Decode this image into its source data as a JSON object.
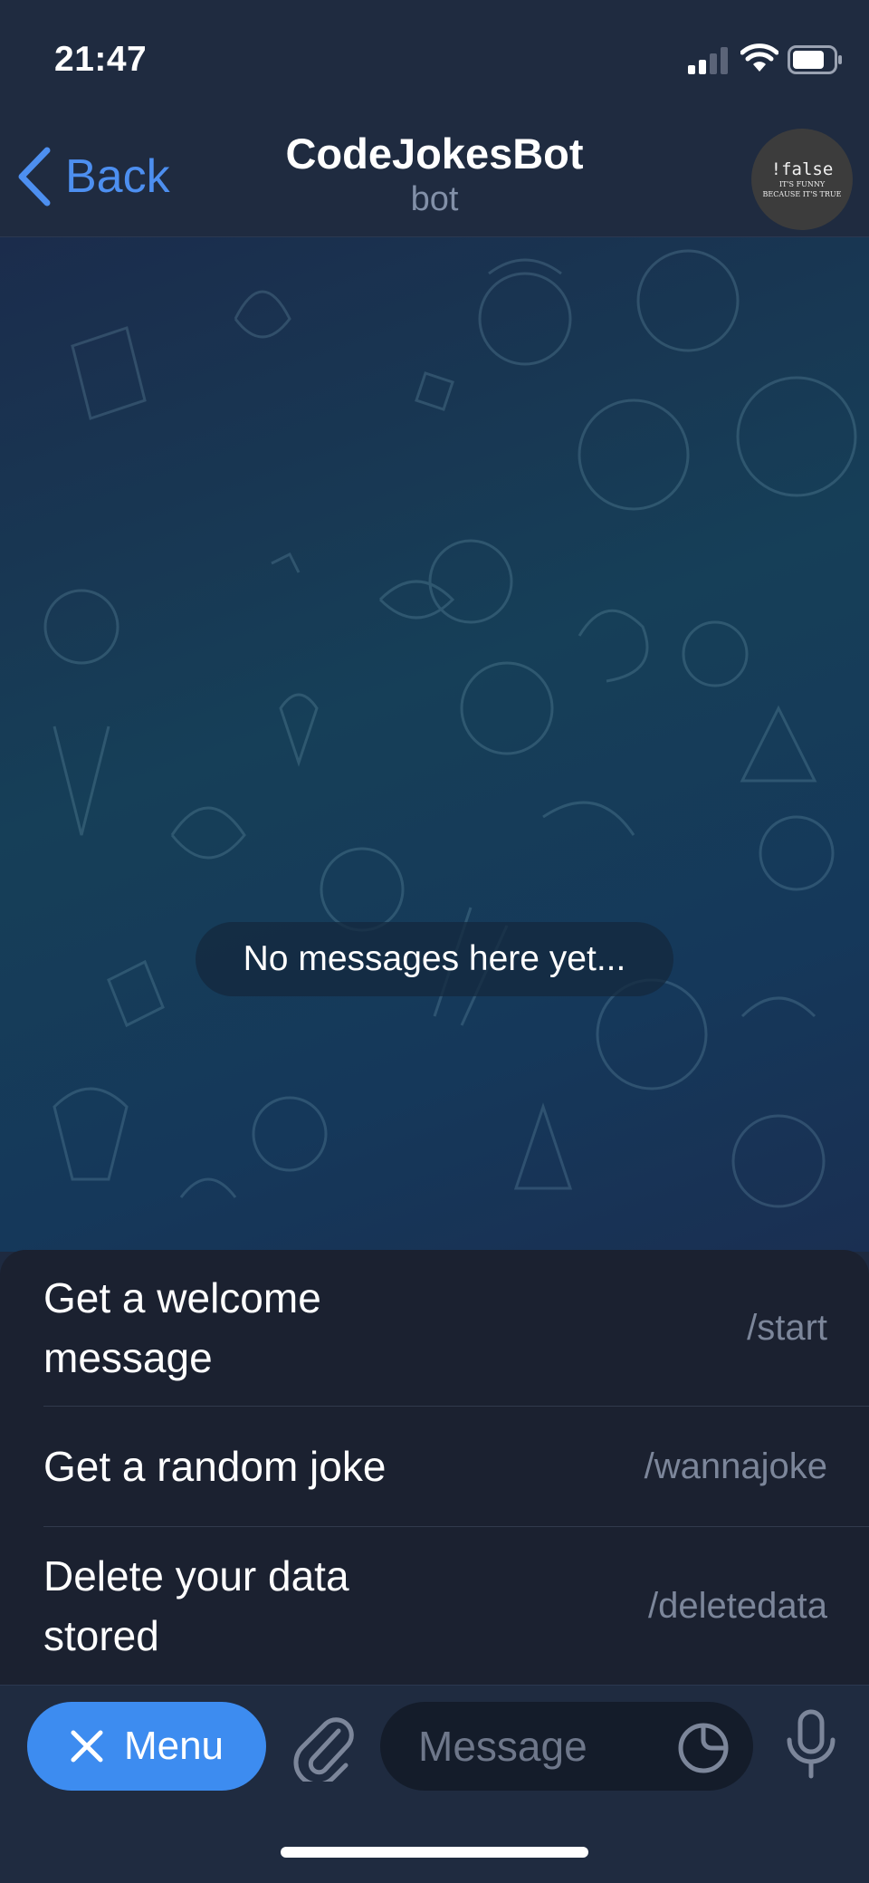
{
  "status_bar": {
    "time": "21:47",
    "icons": [
      "signal-icon",
      "wifi-icon",
      "battery-icon"
    ]
  },
  "nav": {
    "back_label": "Back",
    "title": "CodeJokesBot",
    "subtitle": "bot",
    "avatar": {
      "main_text": "!false",
      "sub_line_1": "IT'S FUNNY",
      "sub_line_2": "BECAUSE IT'S TRUE"
    }
  },
  "chat": {
    "empty_text": "No messages here yet..."
  },
  "commands": [
    {
      "description": "Get a welcome message",
      "command": "/start"
    },
    {
      "description": "Get a random joke",
      "command": "/wannajoke"
    },
    {
      "description": "Delete your data stored",
      "command": "/deletedata"
    }
  ],
  "input_bar": {
    "menu_label": "Menu",
    "message_placeholder": "Message",
    "icons": [
      "close-icon",
      "paperclip-icon",
      "sticker-icon",
      "microphone-icon"
    ]
  },
  "colors": {
    "accent": "#3d8cf0",
    "link": "#4d8ff0",
    "header_bg": "#1f2b40",
    "sheet_bg": "#1b2130",
    "command_text": "#7c869a"
  }
}
